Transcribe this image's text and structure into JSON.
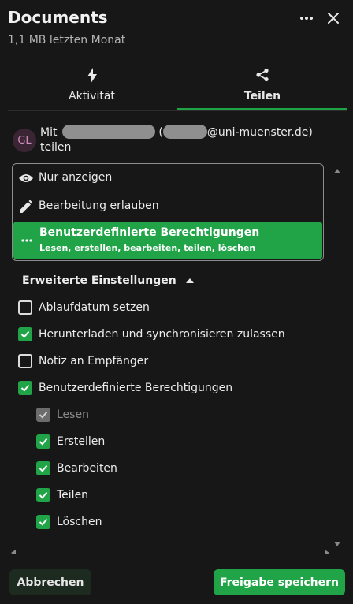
{
  "header": {
    "title": "Documents",
    "subtitle": "1,1 MB letzten Monat",
    "more_icon": "dots-horizontal-icon",
    "close_icon": "close-icon"
  },
  "tabs": [
    {
      "label": "Aktivität",
      "icon": "lightning-icon",
      "active": false
    },
    {
      "label": "Teilen",
      "icon": "share-icon",
      "active": true
    }
  ],
  "share": {
    "avatar_initials": "GL",
    "prefix": "Mit",
    "open_paren": "(",
    "email_domain": "@uni-muenster.de)",
    "suffix": "teilen"
  },
  "permission_dropdown": {
    "options": [
      {
        "label": "Nur anzeigen",
        "icon": "eye-icon",
        "selected": false
      },
      {
        "label": "Bearbeitung erlauben",
        "icon": "pencil-icon",
        "selected": false
      },
      {
        "label": "Benutzerdefinierte Berechtigungen",
        "sub": "Lesen, erstellen, bearbeiten, teilen, löschen",
        "icon": "dots-horizontal-icon",
        "selected": true
      }
    ]
  },
  "advanced": {
    "toggle_label": "Erweiterte Einstellungen",
    "toggle_icon": "triangle-up-icon",
    "checkboxes": [
      {
        "label": "Ablaufdatum setzen",
        "checked": false
      },
      {
        "label": "Herunterladen und synchronisieren zulassen",
        "checked": true
      },
      {
        "label": "Notiz an Empfänger",
        "checked": false
      },
      {
        "label": "Benutzerdefinierte Berechtigungen",
        "checked": true
      }
    ],
    "permissions": [
      {
        "label": "Lesen",
        "checked": true,
        "disabled": true
      },
      {
        "label": "Erstellen",
        "checked": true,
        "disabled": false
      },
      {
        "label": "Bearbeiten",
        "checked": true,
        "disabled": false
      },
      {
        "label": "Teilen",
        "checked": true,
        "disabled": false
      },
      {
        "label": "Löschen",
        "checked": true,
        "disabled": false
      }
    ]
  },
  "footer": {
    "cancel_label": "Abbrechen",
    "save_label": "Freigabe speichern"
  },
  "colors": {
    "accent": "#20a447",
    "background": "#171717"
  }
}
